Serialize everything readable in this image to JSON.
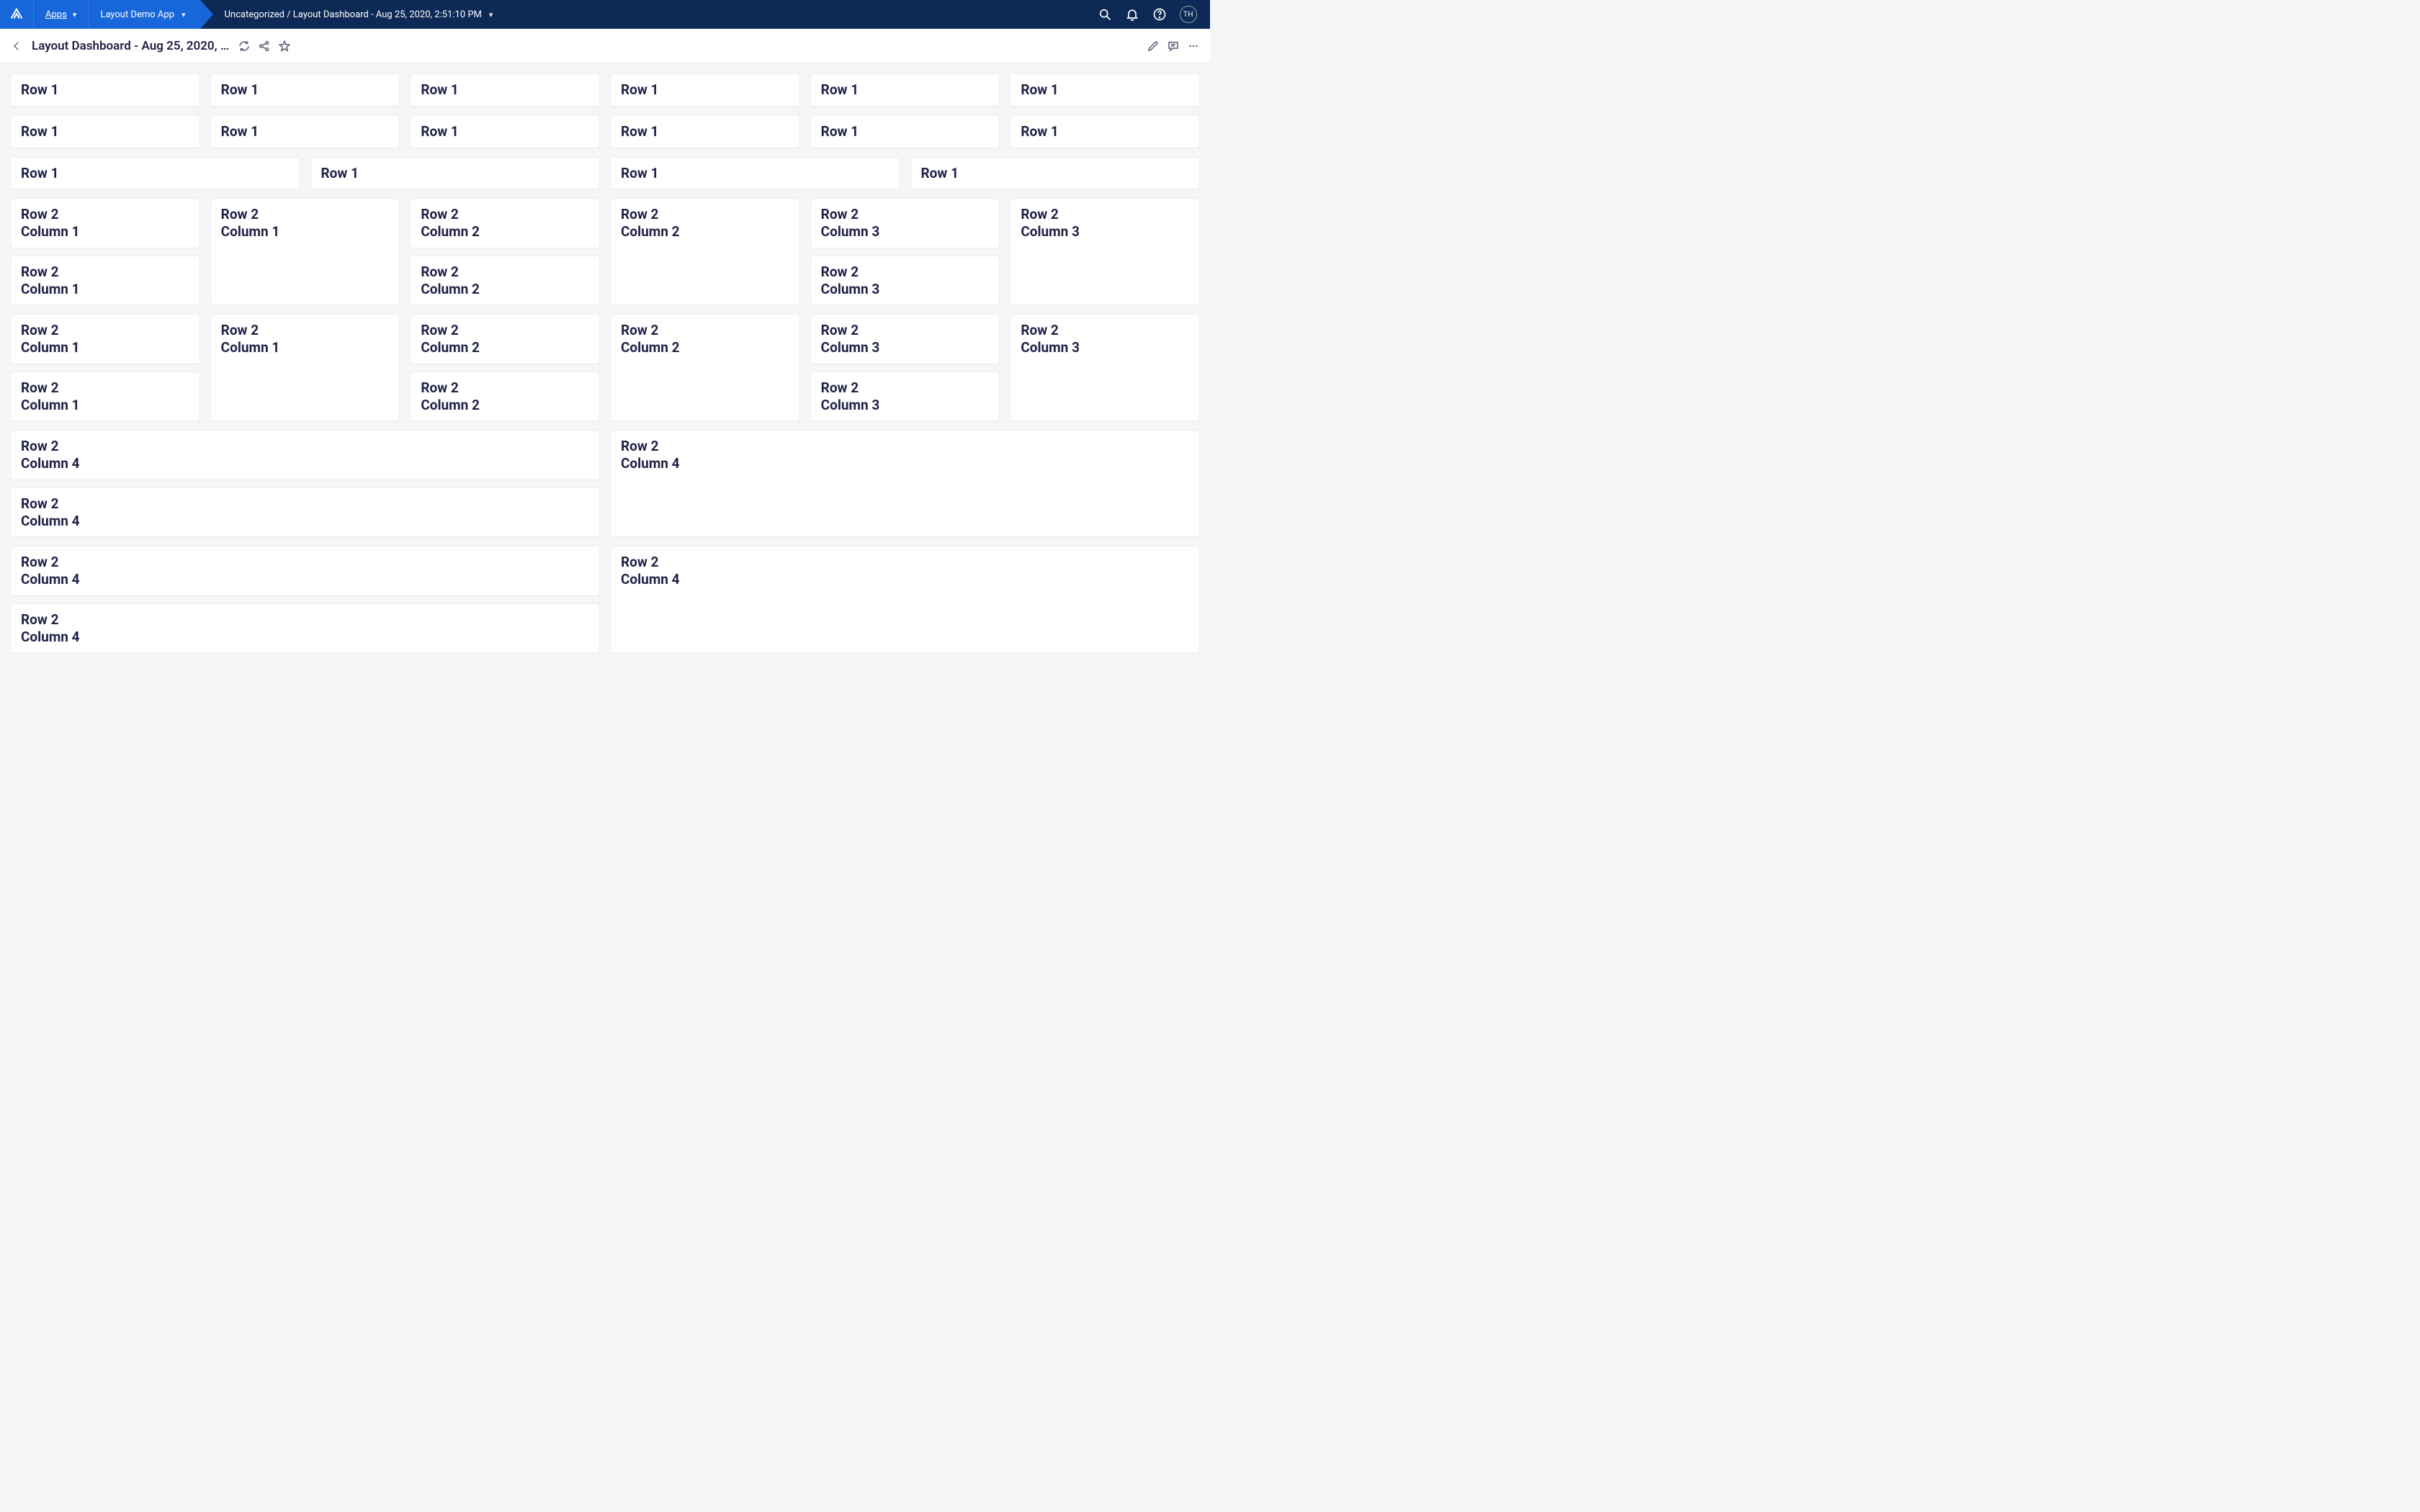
{
  "topbar": {
    "apps_label": "Apps",
    "app_name": "Layout Demo App",
    "breadcrumb": "Uncategorized / Layout Dashboard - Aug 25, 2020, 2:51:10 PM",
    "avatar_initials": "TH"
  },
  "secondbar": {
    "title": "Layout Dashboard - Aug 25, 2020, …"
  },
  "labels": {
    "row1": "Row 1",
    "r2c1": "Row 2\nColumn 1",
    "r2c2": "Row 2\nColumn 2",
    "r2c3": "Row 2\nColumn 3",
    "r2c4": "Row 2\nColumn 4"
  },
  "colors": {
    "accent_blue": "#1766da",
    "dark_navy": "#0d2a56",
    "text": "#1f2147",
    "page_bg": "#f5f6f8"
  }
}
